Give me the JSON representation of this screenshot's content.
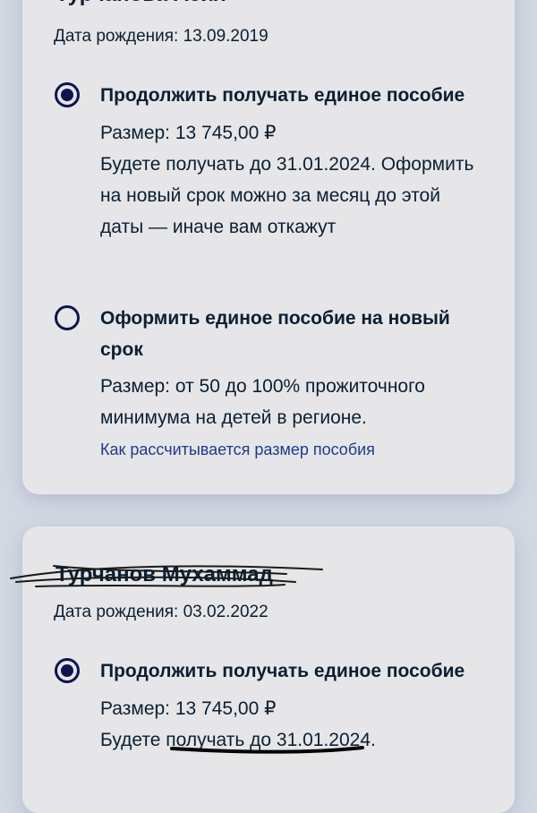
{
  "children": [
    {
      "name": "Турчанова Асия",
      "birth_label": "Дата рождения: 13.09.2019",
      "options": [
        {
          "selected": true,
          "title": "Продолжить получать единое пособие",
          "amount": "Размер: 13 745,00 ₽",
          "note": "Будете получать до 31.01.2024. Оформить на новый срок можно за месяц до этой даты — иначе вам откажут"
        },
        {
          "selected": false,
          "title": "Оформить единое пособие на новый срок",
          "amount": "Размер: от 50 до 100% прожиточного минимума на детей в регионе.",
          "link": "Как рассчитывается размер пособия"
        }
      ]
    },
    {
      "name": "Турчанов Мухаммад",
      "birth_label": "Дата рождения: 03.02.2022",
      "options": [
        {
          "selected": true,
          "title": "Продолжить получать единое пособие",
          "amount": "Размер: 13 745,00 ₽",
          "note": "Будете получать до 31.01.2024."
        }
      ]
    }
  ],
  "colors": {
    "background": "#d3d8e3",
    "card": "#e6e6e8",
    "radio": "#0d1450",
    "link": "#1f3a8a",
    "text": "#0b1f33"
  }
}
